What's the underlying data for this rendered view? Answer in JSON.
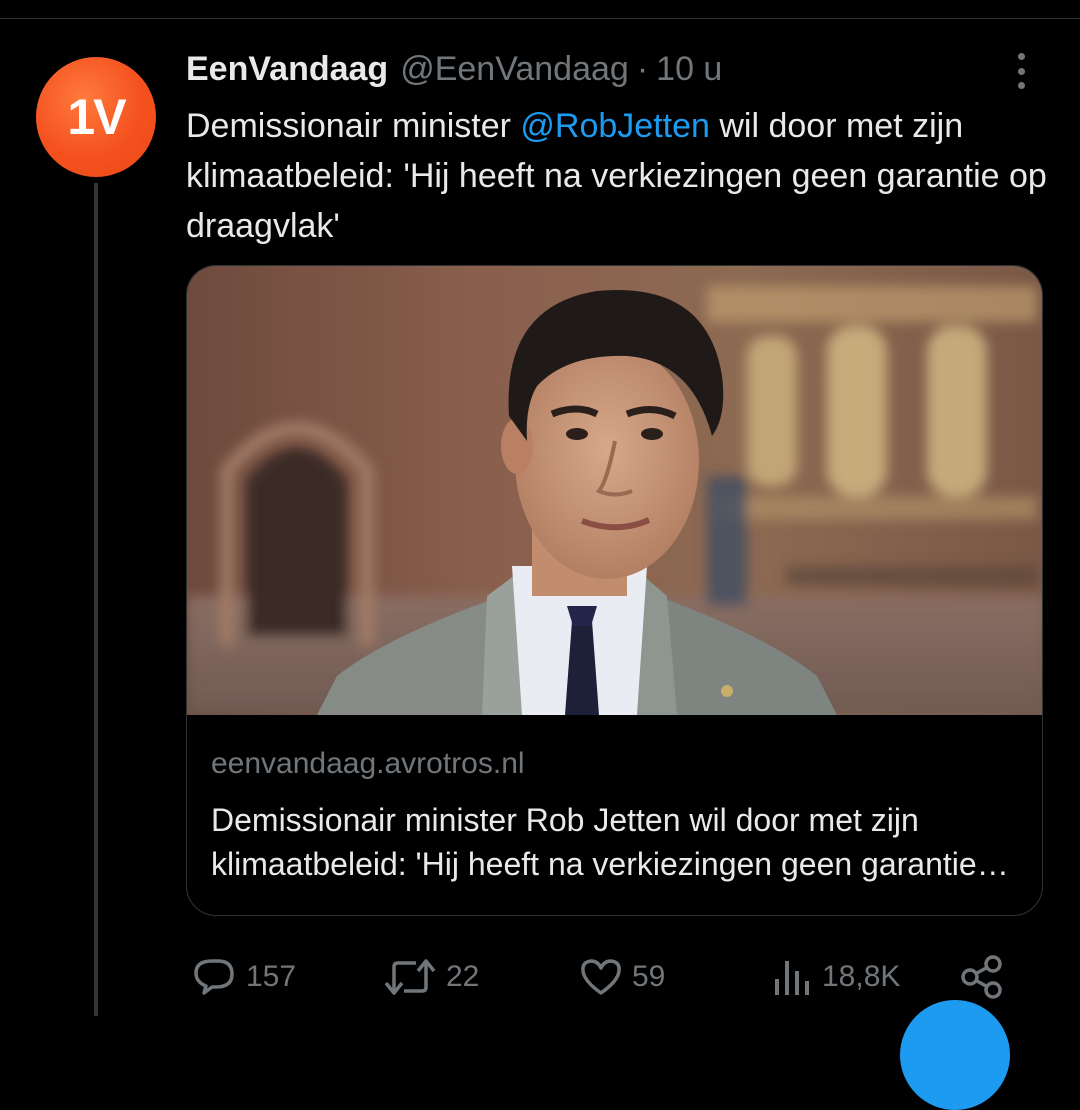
{
  "tweet": {
    "display_name": "EenVandaag",
    "handle": "@EenVandaag",
    "separator": "·",
    "time": "10 u",
    "avatar_text": "1V",
    "text_before": "Demissionair minister ",
    "mention": "@RobJetten",
    "text_after": " wil door met zijn klimaatbeleid: 'Hij heeft na verkiezingen geen garantie op draagvlak'"
  },
  "card": {
    "domain": "eenvandaag.avrotros.nl",
    "title": "Demissionair minister Rob Jetten wil door met zijn klimaatbeleid: 'Hij heeft na verkiezingen geen garantie op draagvlak'"
  },
  "actions": {
    "replies": "157",
    "retweets": "22",
    "likes": "59",
    "views": "18,8K"
  },
  "colors": {
    "background": "#000000",
    "text": "#e7e9ea",
    "secondary": "#71767b",
    "accent": "#1d9bf0",
    "avatar": "#f4511e"
  },
  "icons": [
    "more-icon",
    "reply-icon",
    "retweet-icon",
    "like-icon",
    "views-icon",
    "share-icon"
  ]
}
